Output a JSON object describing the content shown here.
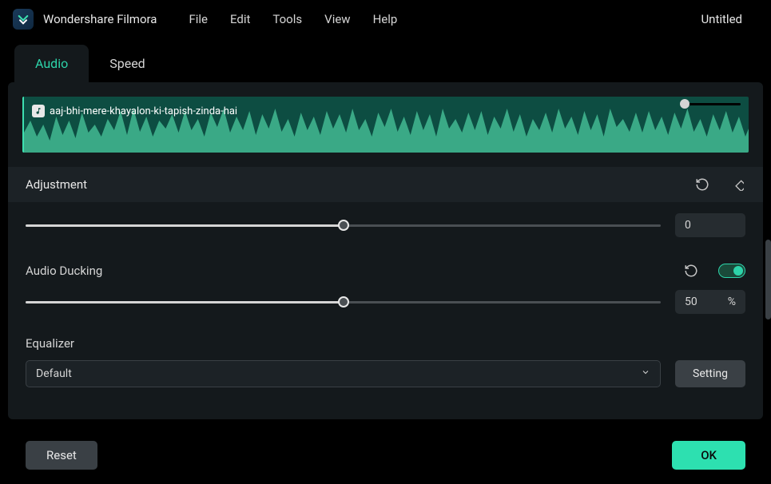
{
  "app": {
    "title": "Wondershare Filmora",
    "document": "Untitled"
  },
  "menu": {
    "items": [
      "File",
      "Edit",
      "Tools",
      "View",
      "Help"
    ]
  },
  "tabs": {
    "items": [
      {
        "label": "Audio",
        "active": true
      },
      {
        "label": "Speed",
        "active": false
      }
    ]
  },
  "track": {
    "name": "aaj-bhi-mere-khayalon-ki-tapish-zinda-hai"
  },
  "adjustment": {
    "header": "Adjustment",
    "pitch": {
      "value": "0",
      "percent": 50
    }
  },
  "audio_ducking": {
    "label": "Audio Ducking",
    "enabled": true,
    "value": "50",
    "unit": "%",
    "percent": 50
  },
  "equalizer": {
    "label": "Equalizer",
    "selected": "Default",
    "setting_btn": "Setting"
  },
  "footer": {
    "reset": "Reset",
    "ok": "OK"
  }
}
